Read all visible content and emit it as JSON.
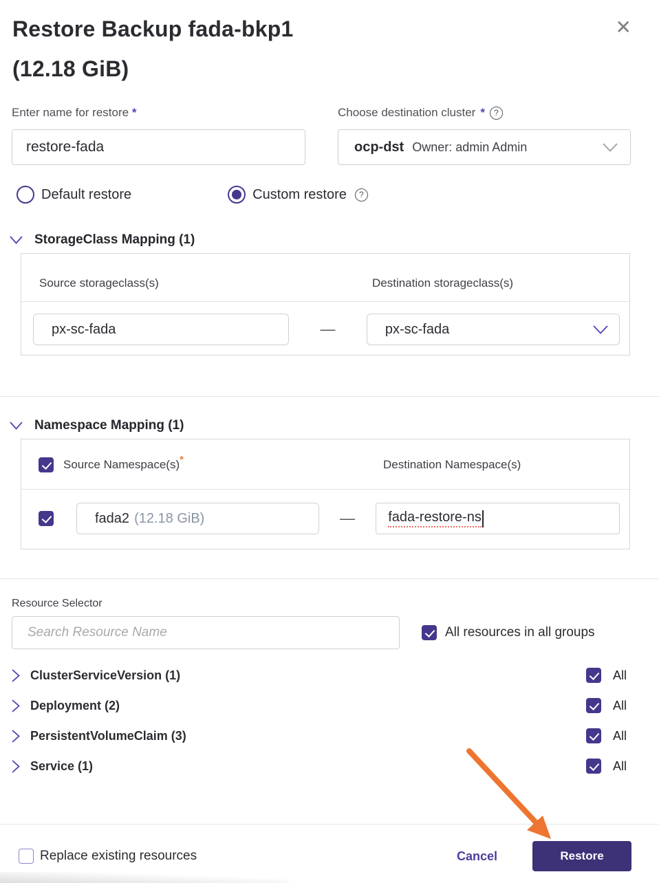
{
  "dialog": {
    "title_line1": "Restore Backup fada-bkp1",
    "title_line2": "(12.18 GiB)"
  },
  "icons": {
    "close_glyph": "✕",
    "help_glyph": "?"
  },
  "name_field": {
    "label": "Enter name for restore",
    "required_mark": "*",
    "value": "restore-fada"
  },
  "cluster_field": {
    "label": "Choose destination cluster",
    "required_mark": "*",
    "value": "ocp-dst",
    "owner": "Owner: admin Admin"
  },
  "restore_type": {
    "options": [
      {
        "label": "Default restore",
        "selected": false
      },
      {
        "label": "Custom restore",
        "selected": true
      }
    ]
  },
  "storageclass_mapping": {
    "title": "StorageClass Mapping (1)",
    "source_header": "Source storageclass(s)",
    "destination_header": "Destination storageclass(s)",
    "dash": "—",
    "row": {
      "source": "px-sc-fada",
      "destination": "px-sc-fada"
    }
  },
  "namespace_mapping": {
    "title": "Namespace Mapping (1)",
    "source_header": "Source Namespace(s)",
    "source_required_mark": "*",
    "destination_header": "Destination Namespace(s)",
    "dash": "—",
    "row": {
      "source_name": "fada2",
      "source_size": "(12.18 GiB)",
      "destination": "fada-restore-ns",
      "source_checked": true
    }
  },
  "resource_selector": {
    "label": "Resource Selector",
    "search_placeholder": "Search Resource Name",
    "all_resources_label": "All resources in all groups",
    "all_resources_checked": true,
    "groups": [
      {
        "label": "ClusterServiceVersion (1)",
        "all_label": "All",
        "checked": true
      },
      {
        "label": "Deployment (2)",
        "all_label": "All",
        "checked": true
      },
      {
        "label": "PersistentVolumeClaim (3)",
        "all_label": "All",
        "checked": true
      },
      {
        "label": "Service (1)",
        "all_label": "All",
        "checked": true
      }
    ]
  },
  "footer": {
    "replace_label": "Replace existing resources",
    "replace_checked": false,
    "cancel_label": "Cancel",
    "restore_label": "Restore"
  },
  "colors": {
    "primary": "#43388c",
    "button": "#3d3178",
    "cancel": "#4b3e9c",
    "arrow": "#ee7531",
    "req-orange": "#f07a3c",
    "req-indigo": "#4a44c0",
    "chev": "#4e43b2"
  }
}
